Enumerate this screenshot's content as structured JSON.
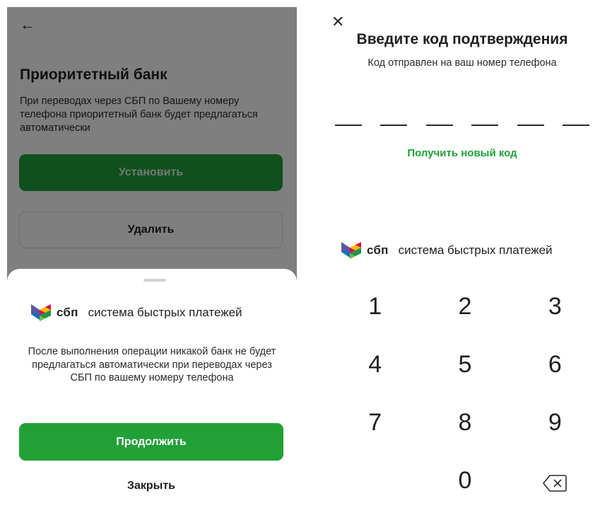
{
  "left": {
    "back_icon": "arrow-left-icon",
    "title": "Приоритетный банк",
    "description": "При переводах через СБП по Вашему номеру телефона приоритетный банк будет предлагаться автоматически",
    "set_button": "Установить",
    "delete_button": "Удалить",
    "sheet": {
      "logo_word": "сбп",
      "logo_tagline": "система быстрых платежей",
      "message": "После выполнения операции никакой банк не будет предлагаться автоматически при переводах через СБП по вашему номеру телефона",
      "continue_button": "Продолжить",
      "close_button": "Закрыть"
    }
  },
  "right": {
    "close_icon": "close-icon",
    "title": "Введите код подтверждения",
    "subtitle": "Код отправлен на ваш номер телефона",
    "code_slots": 6,
    "new_code_link": "Получить новый код",
    "logo_word": "сбп",
    "logo_tagline": "система быстрых платежей",
    "keys": [
      "1",
      "2",
      "3",
      "4",
      "5",
      "6",
      "7",
      "8",
      "9",
      "",
      "0",
      "⌫"
    ]
  },
  "colors": {
    "accent": "#21a038",
    "overlay": "rgba(0,0,0,0.5)"
  }
}
